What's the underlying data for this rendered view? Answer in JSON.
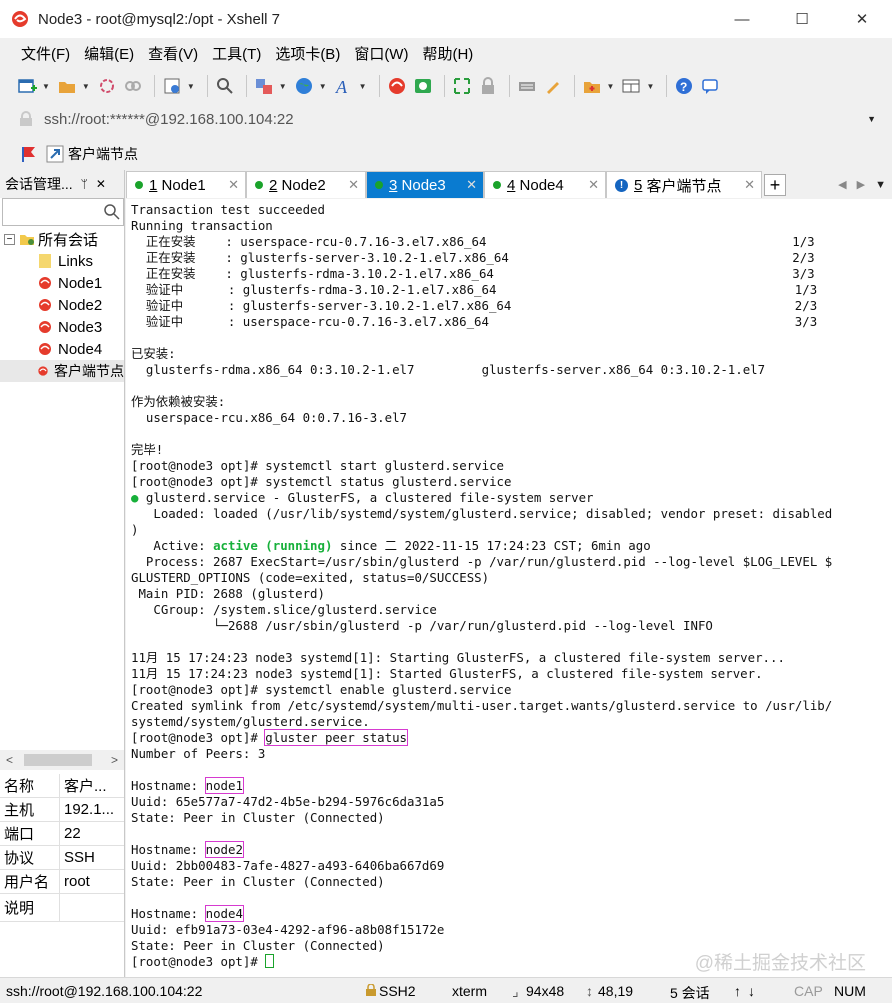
{
  "window": {
    "title": "Node3 - root@mysql2:/opt - Xshell 7",
    "minimize": "—",
    "maximize": "☐",
    "close": "✕"
  },
  "menu": [
    "文件(F)",
    "编辑(E)",
    "查看(V)",
    "工具(T)",
    "选项卡(B)",
    "窗口(W)",
    "帮助(H)"
  ],
  "address": {
    "text": "ssh://root:******@192.168.100.104:22"
  },
  "quickbar": {
    "label": "客户端节点"
  },
  "session_panel": {
    "title": "会话管理...",
    "pin": "ᛘ",
    "close": "✕",
    "tree": [
      {
        "label": "所有会话",
        "level": 0
      },
      {
        "label": "Links",
        "level": 1
      },
      {
        "label": "Node1",
        "level": 1
      },
      {
        "label": "Node2",
        "level": 1
      },
      {
        "label": "Node3",
        "level": 1
      },
      {
        "label": "Node4",
        "level": 1
      },
      {
        "label": "客户端节点",
        "level": 1
      }
    ],
    "props": [
      {
        "key": "名称",
        "value": "客户..."
      },
      {
        "key": "主机",
        "value": "192.1..."
      },
      {
        "key": "端口",
        "value": "22"
      },
      {
        "key": "协议",
        "value": "SSH"
      },
      {
        "key": "用户名",
        "value": "root"
      },
      {
        "key": "说明",
        "value": ""
      }
    ]
  },
  "tabs": [
    {
      "num": "1",
      "label": "Node1",
      "status": "connected"
    },
    {
      "num": "2",
      "label": "Node2",
      "status": "connected"
    },
    {
      "num": "3",
      "label": "Node3",
      "status": "connected"
    },
    {
      "num": "4",
      "label": "Node4",
      "status": "connected"
    },
    {
      "num": "5",
      "label": "客户端节点",
      "status": "info"
    }
  ],
  "terminal": {
    "lines": [
      "Transaction test succeeded",
      "Running transaction",
      "  正在安装    : userspace-rcu-0.7.16-3.el7.x86_64                                         1/3",
      "  正在安装    : glusterfs-server-3.10.2-1.el7.x86_64                                      2/3",
      "  正在安装    : glusterfs-rdma-3.10.2-1.el7.x86_64                                        3/3",
      "  验证中      : glusterfs-rdma-3.10.2-1.el7.x86_64                                        1/3",
      "  验证中      : glusterfs-server-3.10.2-1.el7.x86_64                                      2/3",
      "  验证中      : userspace-rcu-0.7.16-3.el7.x86_64                                         3/3",
      "",
      "已安装:",
      "  glusterfs-rdma.x86_64 0:3.10.2-1.el7         glusterfs-server.x86_64 0:3.10.2-1.el7",
      "",
      "作为依赖被安装:",
      "  userspace-rcu.x86_64 0:0.7.16-3.el7",
      "",
      "完毕!",
      "[root@node3 opt]# systemctl start glusterd.service",
      "[root@node3 opt]# systemctl status glusterd.service",
      "● glusterd.service - GlusterFS, a clustered file-system server",
      "   Loaded: loaded (/usr/lib/systemd/system/glusterd.service; disabled; vendor preset: disabled",
      ")",
      "   Active: active (running) since 二 2022-11-15 17:24:23 CST; 6min ago",
      "  Process: 2687 ExecStart=/usr/sbin/glusterd -p /var/run/glusterd.pid --log-level $LOG_LEVEL $",
      "GLUSTERD_OPTIONS (code=exited, status=0/SUCCESS)",
      " Main PID: 2688 (glusterd)",
      "   CGroup: /system.slice/glusterd.service",
      "           └─2688 /usr/sbin/glusterd -p /var/run/glusterd.pid --log-level INFO",
      "",
      "11月 15 17:24:23 node3 systemd[1]: Starting GlusterFS, a clustered file-system server...",
      "11月 15 17:24:23 node3 systemd[1]: Started GlusterFS, a clustered file-system server.",
      "[root@node3 opt]# systemctl enable glusterd.service",
      "Created symlink from /etc/systemd/system/multi-user.target.wants/glusterd.service to /usr/lib/",
      "systemd/system/glusterd.service.",
      "[root@node3 opt]# gluster peer status",
      "Number of Peers: 3",
      "",
      "Hostname: node1",
      "Uuid: 65e577a7-47d2-4b5e-b294-5976c6da31a5",
      "State: Peer in Cluster (Connected)",
      "",
      "Hostname: node2",
      "Uuid: 2bb00483-7afe-4827-a493-6406ba667d69",
      "State: Peer in Cluster (Connected)",
      "",
      "Hostname: node4",
      "Uuid: efb91a73-03e4-4292-af96-a8b08f15172e",
      "State: Peer in Cluster (Connected)",
      "[root@node3 opt]# "
    ],
    "active_status": "active (running)",
    "watermark": "@稀土掘金技术社区"
  },
  "statusbar": {
    "connection": "ssh://root@192.168.100.104:22",
    "protocol": "SSH2",
    "terminal_type": "xterm",
    "size": "94x48",
    "cursor_pos": "48,19",
    "sessions": "5 会话",
    "caps": "CAP",
    "num": "NUM"
  },
  "colors": {
    "active_tab": "#0a7bd0",
    "connected_dot": "#1aa32b",
    "highlight_box": "#d63ad0",
    "active_text": "#17b03a"
  }
}
